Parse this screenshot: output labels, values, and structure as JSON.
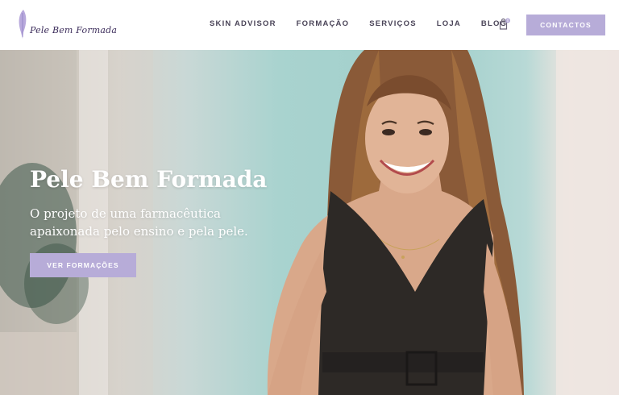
{
  "header": {
    "logo_text": "Pele Bem Formada",
    "logo_icon": "feather-logo-icon",
    "nav": [
      {
        "label": "SKIN ADVISOR"
      },
      {
        "label": "FORMAÇÃO"
      },
      {
        "label": "SERVIÇOS"
      },
      {
        "label": "LOJA"
      },
      {
        "label": "BLOG"
      }
    ],
    "cart_icon": "shopping-bag-icon",
    "cart_count": "0",
    "contact_label": "CONTACTOS"
  },
  "hero": {
    "title": "Pele Bem Formada",
    "subtitle": "O projeto de uma farmacêutica apaixonada pelo ensino e pela pele.",
    "button_label": "VER FORMAÇÕES",
    "image_subject": "smiling woman with long brown hair in a dark sleeveless top"
  },
  "colors": {
    "accent": "#b7acd8",
    "nav_text": "#4a4458",
    "hero_bg": "#a0cfcb"
  }
}
